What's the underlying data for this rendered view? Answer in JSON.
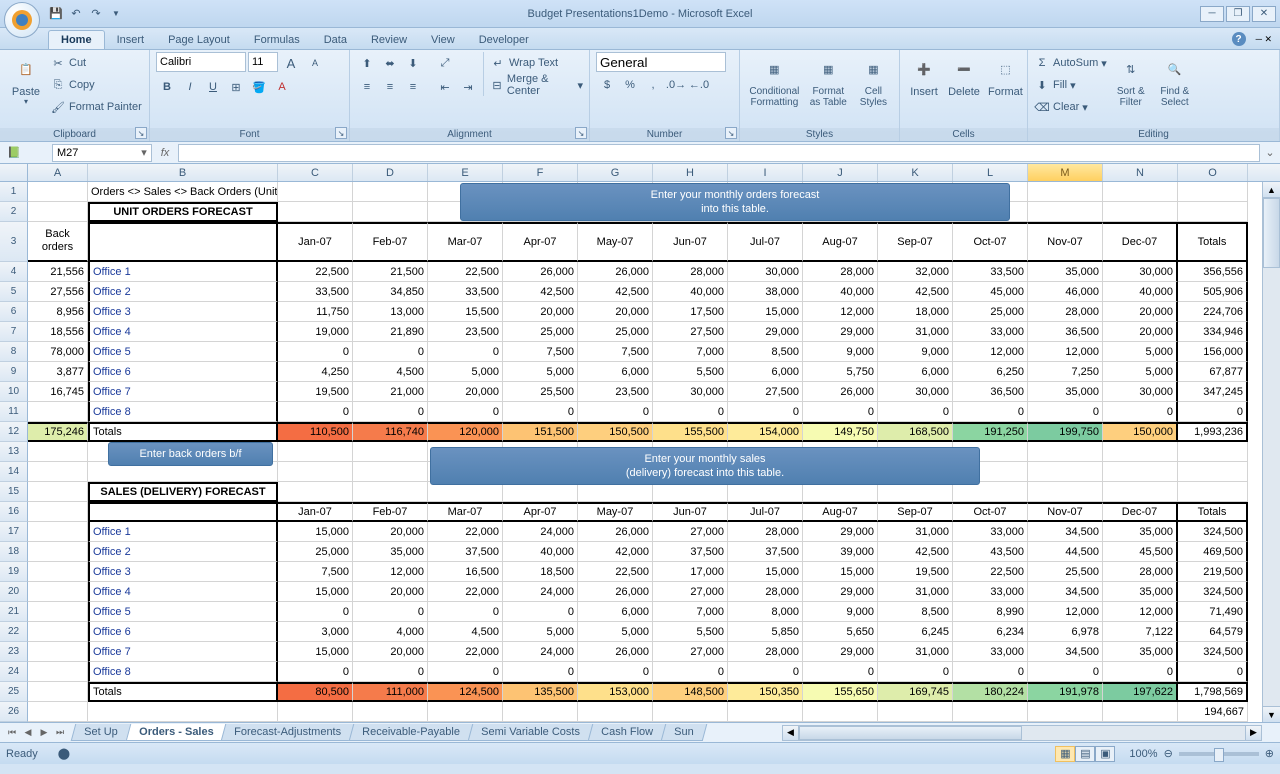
{
  "app": {
    "title": "Budget Presentations1Demo - Microsoft Excel",
    "status": "Ready",
    "zoom": "100%"
  },
  "ribbon": {
    "tabs": [
      "Home",
      "Insert",
      "Page Layout",
      "Formulas",
      "Data",
      "Review",
      "View",
      "Developer"
    ],
    "activeTab": "Home",
    "clipboard": {
      "paste": "Paste",
      "cut": "Cut",
      "copy": "Copy",
      "fp": "Format Painter",
      "label": "Clipboard"
    },
    "font": {
      "name": "Calibri",
      "size": "11",
      "label": "Font"
    },
    "alignment": {
      "wrap": "Wrap Text",
      "merge": "Merge & Center",
      "label": "Alignment"
    },
    "number": {
      "format": "General",
      "label": "Number"
    },
    "styles": {
      "cond": "Conditional Formatting",
      "fmt": "Format as Table",
      "cell": "Cell Styles",
      "label": "Styles"
    },
    "cells": {
      "insert": "Insert",
      "delete": "Delete",
      "format": "Format",
      "label": "Cells"
    },
    "editing": {
      "autosum": "AutoSum",
      "fill": "Fill",
      "clear": "Clear",
      "sort": "Sort & Filter",
      "find": "Find & Select",
      "label": "Editing"
    }
  },
  "namebox": "M27",
  "sheet": {
    "title_row": "Orders <> Sales <> Back Orders (Units)",
    "unit_forecast_header": "UNIT ORDERS FORECAST",
    "sales_forecast_header": "SALES (DELIVERY) FORECAST",
    "back_orders_label": "Back orders",
    "months": [
      "Jan-07",
      "Feb-07",
      "Mar-07",
      "Apr-07",
      "May-07",
      "Jun-07",
      "Jul-07",
      "Aug-07",
      "Sep-07",
      "Oct-07",
      "Nov-07",
      "Dec-07"
    ],
    "totals_label": "Totals",
    "offices": [
      "Office 1",
      "Office 2",
      "Office 3",
      "Office 4",
      "Office 5",
      "Office 6",
      "Office 7",
      "Office 8"
    ],
    "back_orders": [
      "21,556",
      "27,556",
      "8,956",
      "18,556",
      "78,000",
      "3,877",
      "16,745",
      ""
    ],
    "back_orders_total": "175,246",
    "orders_data": [
      [
        "22,500",
        "21,500",
        "22,500",
        "26,000",
        "26,000",
        "28,000",
        "30,000",
        "28,000",
        "32,000",
        "33,500",
        "35,000",
        "30,000",
        "356,556"
      ],
      [
        "33,500",
        "34,850",
        "33,500",
        "42,500",
        "42,500",
        "40,000",
        "38,000",
        "40,000",
        "42,500",
        "45,000",
        "46,000",
        "40,000",
        "505,906"
      ],
      [
        "11,750",
        "13,000",
        "15,500",
        "20,000",
        "20,000",
        "17,500",
        "15,000",
        "12,000",
        "18,000",
        "25,000",
        "28,000",
        "20,000",
        "224,706"
      ],
      [
        "19,000",
        "21,890",
        "23,500",
        "25,000",
        "25,000",
        "27,500",
        "29,000",
        "29,000",
        "31,000",
        "33,000",
        "36,500",
        "20,000",
        "334,946"
      ],
      [
        "0",
        "0",
        "0",
        "7,500",
        "7,500",
        "7,000",
        "8,500",
        "9,000",
        "9,000",
        "12,000",
        "12,000",
        "5,000",
        "156,000"
      ],
      [
        "4,250",
        "4,500",
        "5,000",
        "5,000",
        "6,000",
        "5,500",
        "6,000",
        "5,750",
        "6,000",
        "6,250",
        "7,250",
        "5,000",
        "67,877"
      ],
      [
        "19,500",
        "21,000",
        "20,000",
        "25,500",
        "23,500",
        "30,000",
        "27,500",
        "26,000",
        "30,000",
        "36,500",
        "35,000",
        "30,000",
        "347,245"
      ],
      [
        "0",
        "0",
        "0",
        "0",
        "0",
        "0",
        "0",
        "0",
        "0",
        "0",
        "0",
        "0",
        "0"
      ]
    ],
    "orders_totals": [
      "110,500",
      "116,740",
      "120,000",
      "151,500",
      "150,500",
      "155,500",
      "154,000",
      "149,750",
      "168,500",
      "191,250",
      "199,750",
      "150,000",
      "1,993,236"
    ],
    "sales_data": [
      [
        "15,000",
        "20,000",
        "22,000",
        "24,000",
        "26,000",
        "27,000",
        "28,000",
        "29,000",
        "31,000",
        "33,000",
        "34,500",
        "35,000",
        "324,500"
      ],
      [
        "25,000",
        "35,000",
        "37,500",
        "40,000",
        "42,000",
        "37,500",
        "37,500",
        "39,000",
        "42,500",
        "43,500",
        "44,500",
        "45,500",
        "469,500"
      ],
      [
        "7,500",
        "12,000",
        "16,500",
        "18,500",
        "22,500",
        "17,000",
        "15,000",
        "15,000",
        "19,500",
        "22,500",
        "25,500",
        "28,000",
        "219,500"
      ],
      [
        "15,000",
        "20,000",
        "22,000",
        "24,000",
        "26,000",
        "27,000",
        "28,000",
        "29,000",
        "31,000",
        "33,000",
        "34,500",
        "35,000",
        "324,500"
      ],
      [
        "0",
        "0",
        "0",
        "0",
        "6,000",
        "7,000",
        "8,000",
        "9,000",
        "8,500",
        "8,990",
        "12,000",
        "12,000",
        "71,490"
      ],
      [
        "3,000",
        "4,000",
        "4,500",
        "5,000",
        "5,000",
        "5,500",
        "5,850",
        "5,650",
        "6,245",
        "6,234",
        "6,978",
        "7,122",
        "64,579"
      ],
      [
        "15,000",
        "20,000",
        "22,000",
        "24,000",
        "26,000",
        "27,000",
        "28,000",
        "29,000",
        "31,000",
        "33,000",
        "34,500",
        "35,000",
        "324,500"
      ],
      [
        "0",
        "0",
        "0",
        "0",
        "0",
        "0",
        "0",
        "0",
        "0",
        "0",
        "0",
        "0",
        "0"
      ]
    ],
    "sales_totals": [
      "80,500",
      "111,000",
      "124,500",
      "135,500",
      "153,000",
      "148,500",
      "150,350",
      "155,650",
      "169,745",
      "180,224",
      "191,978",
      "197,622",
      "1,798,569"
    ],
    "partial_row26": "194,667"
  },
  "callouts": {
    "orders": "Enter your monthly  orders forecast\ninto this table.",
    "back_orders": "Enter back orders b/f",
    "sales": "Enter your monthly sales\n(delivery) forecast into this table."
  },
  "sheet_tabs": [
    "Set Up",
    "Orders - Sales",
    "Forecast-Adjustments",
    "Receivable-Payable",
    "Semi Variable Costs",
    "Cash Flow",
    "Sun"
  ],
  "active_sheet": "Orders - Sales"
}
